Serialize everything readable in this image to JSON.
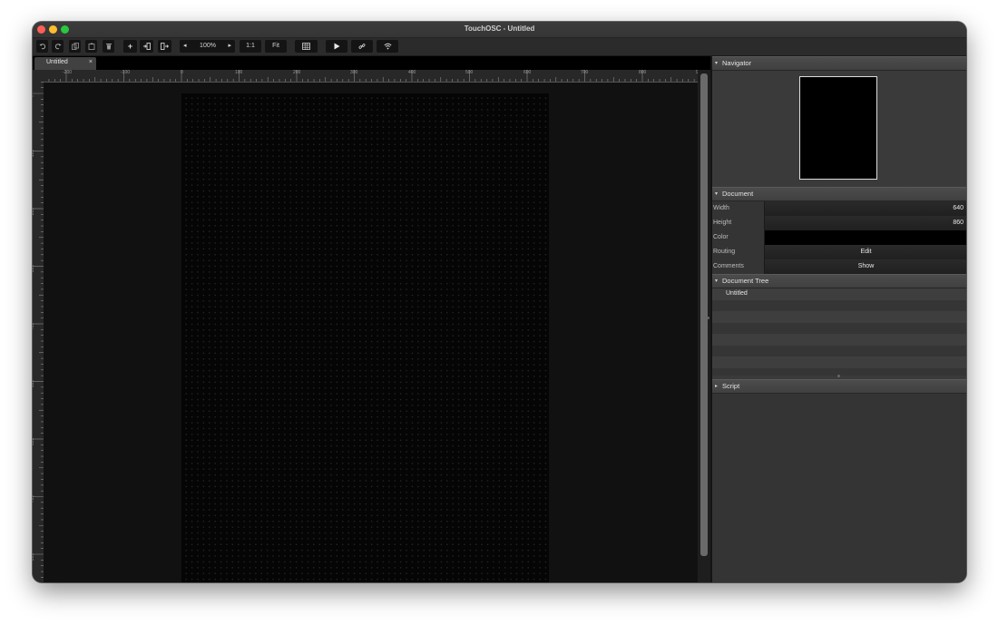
{
  "window": {
    "title": "TouchOSC - Untitled"
  },
  "toolbar": {
    "undo_icon": "undo-icon",
    "redo_icon": "redo-icon",
    "copy_icon": "copy-icon",
    "paste_icon": "paste-icon",
    "delete_icon": "trash-icon",
    "add_label": "+",
    "zoom_out_label": "◂",
    "zoom_level": "100%",
    "zoom_in_label": "▸",
    "one_to_one_label": "1:1",
    "fit_label": "Fit"
  },
  "tabs": [
    {
      "label": "Untitled",
      "close": "×"
    }
  ],
  "rulers": {
    "horizontal_ticks": [
      "-200",
      "-100",
      "0",
      "100",
      "200",
      "300",
      "400",
      "500",
      "600",
      "700",
      "800",
      "9"
    ],
    "vertical_ticks": [
      "0",
      "100",
      "200",
      "300",
      "400",
      "500",
      "600",
      "700",
      "800"
    ]
  },
  "panel": {
    "navigator": {
      "title": "Navigator"
    },
    "document": {
      "title": "Document",
      "width_label": "Width",
      "width_value": "640",
      "height_label": "Height",
      "height_value": "860",
      "color_label": "Color",
      "color_value": "#000000",
      "routing_label": "Routing",
      "routing_value": "Edit",
      "comments_label": "Comments",
      "comments_value": "Show"
    },
    "document_tree": {
      "title": "Document Tree",
      "items": [
        "Untitled"
      ]
    },
    "script": {
      "title": "Script"
    }
  },
  "colors": {
    "canvas": "#111111",
    "page": "#050505",
    "panel": "#343434"
  }
}
